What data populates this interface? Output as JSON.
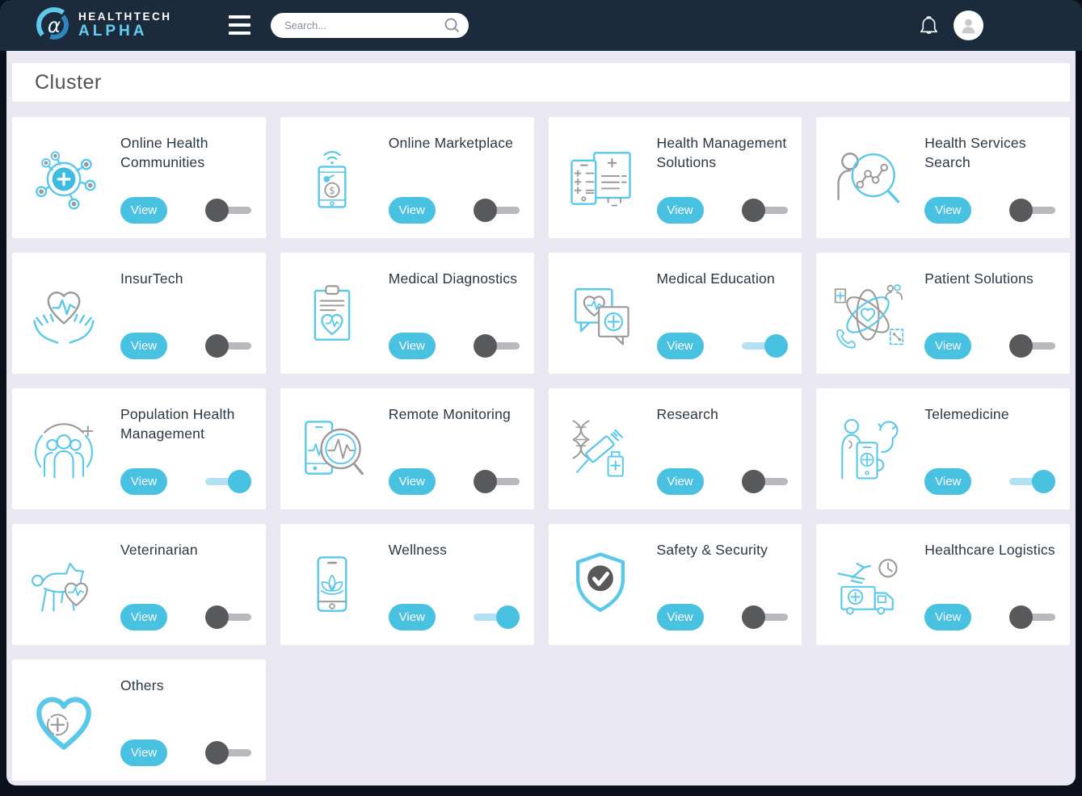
{
  "theme": {
    "accent": "#49c1e0",
    "navbar_bg": "#1c2b3c",
    "page_bg": "#e9e7f2",
    "card_bg": "#fefefe",
    "toggle_on_color": "#49c1e0",
    "toggle_off_color": "#58595b",
    "icon_cyan": "#5ac8ea",
    "icon_grey": "#9a9a9a"
  },
  "navbar": {
    "brand": {
      "logo_icon": "alpha-logo-icon",
      "line1": "HEALTHTECH",
      "line2": "ALPHA"
    },
    "menu_icon": "hamburger-icon",
    "search": {
      "placeholder": "Search...",
      "icon": "search-icon"
    },
    "notification_icon": "bell-icon",
    "avatar_icon": "user-avatar"
  },
  "page": {
    "title": "Cluster"
  },
  "cards": [
    {
      "title": "Online Health Communities",
      "icon": "online-health-communities-icon",
      "button_label": "View",
      "toggle_on": false
    },
    {
      "title": "Online Marketplace",
      "icon": "online-marketplace-icon",
      "button_label": "View",
      "toggle_on": false
    },
    {
      "title": "Health Management Solutions",
      "icon": "health-management-solutions-icon",
      "button_label": "View",
      "toggle_on": false
    },
    {
      "title": "Health Services Search",
      "icon": "health-services-search-icon",
      "button_label": "View",
      "toggle_on": false
    },
    {
      "title": "InsurTech",
      "icon": "insurtech-icon",
      "button_label": "View",
      "toggle_on": false
    },
    {
      "title": "Medical Diagnostics",
      "icon": "medical-diagnostics-icon",
      "button_label": "View",
      "toggle_on": false
    },
    {
      "title": "Medical Education",
      "icon": "medical-education-icon",
      "button_label": "View",
      "toggle_on": true
    },
    {
      "title": "Patient Solutions",
      "icon": "patient-solutions-icon",
      "button_label": "View",
      "toggle_on": false
    },
    {
      "title": "Population Health Management",
      "icon": "population-health-management-icon",
      "button_label": "View",
      "toggle_on": true
    },
    {
      "title": "Remote Monitoring",
      "icon": "remote-monitoring-icon",
      "button_label": "View",
      "toggle_on": false
    },
    {
      "title": "Research",
      "icon": "research-icon",
      "button_label": "View",
      "toggle_on": false
    },
    {
      "title": "Telemedicine",
      "icon": "telemedicine-icon",
      "button_label": "View",
      "toggle_on": true
    },
    {
      "title": "Veterinarian",
      "icon": "veterinarian-icon",
      "button_label": "View",
      "toggle_on": false
    },
    {
      "title": "Wellness",
      "icon": "wellness-icon",
      "button_label": "View",
      "toggle_on": true
    },
    {
      "title": "Safety & Security",
      "icon": "safety-security-icon",
      "button_label": "View",
      "toggle_on": false
    },
    {
      "title": "Healthcare Logistics",
      "icon": "healthcare-logistics-icon",
      "button_label": "View",
      "toggle_on": false
    },
    {
      "title": "Others",
      "icon": "others-icon",
      "button_label": "View",
      "toggle_on": false
    }
  ]
}
